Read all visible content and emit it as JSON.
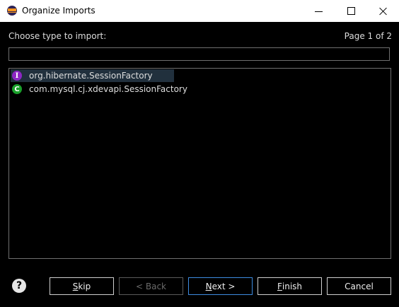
{
  "window": {
    "title": "Organize Imports",
    "app_icon": "eclipse-icon",
    "controls": [
      "minimize-icon",
      "maximize-icon",
      "close-icon"
    ]
  },
  "dialog": {
    "prompt": "Choose type to import:",
    "page_indicator": "Page 1 of 2",
    "filter_value": "",
    "types": [
      {
        "kind": "I",
        "kind_icon": "interface-icon",
        "label": "org.hibernate.SessionFactory",
        "selected": true
      },
      {
        "kind": "C",
        "kind_icon": "class-icon",
        "label": "com.mysql.cj.xdevapi.SessionFactory",
        "selected": false
      }
    ]
  },
  "buttons": {
    "help_glyph": "?",
    "skip_mnemonic": "S",
    "skip_rest": "kip",
    "back_label": "< Back",
    "next_mnemonic": "N",
    "next_rest": "ext >",
    "finish_mnemonic": "F",
    "finish_rest": "inish",
    "cancel_label": "Cancel"
  },
  "colors": {
    "background": "#000000",
    "selection": "#21303d",
    "interface_badge": "#8d26c4",
    "class_badge": "#1aa12b",
    "default_button_border": "#3d8be0"
  }
}
